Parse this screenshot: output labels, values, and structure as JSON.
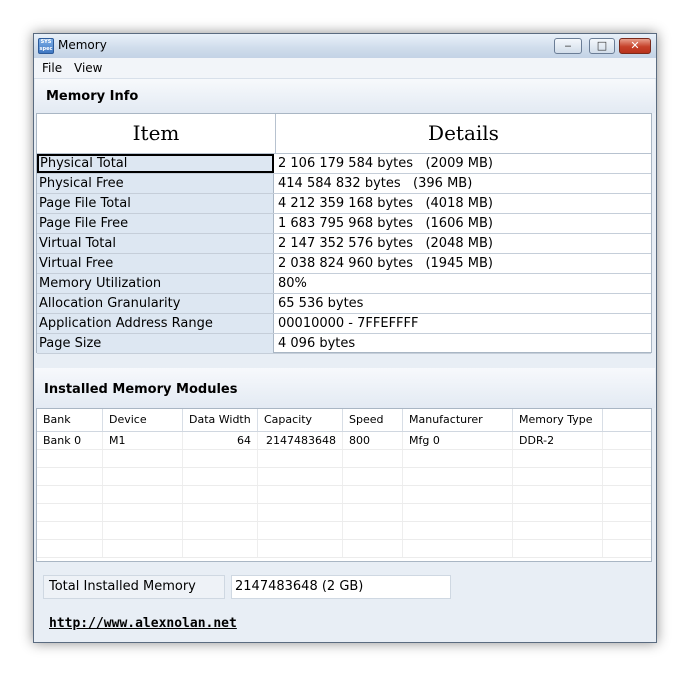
{
  "window": {
    "title": "Memory",
    "icon_text": "SYS spec"
  },
  "menu": [
    "File",
    "View"
  ],
  "memory_info": {
    "section_title": "Memory Info",
    "col_item": "Item",
    "col_details": "Details",
    "rows": [
      {
        "item": "Physical Total",
        "value": "2 106 179 584 bytes   (2009 MB)"
      },
      {
        "item": "Physical Free",
        "value": "414 584 832 bytes   (396 MB)"
      },
      {
        "item": "Page File Total",
        "value": "4 212 359 168 bytes   (4018 MB)"
      },
      {
        "item": "Page File Free",
        "value": "1 683 795 968 bytes   (1606 MB)"
      },
      {
        "item": "Virtual Total",
        "value": "2 147 352 576 bytes   (2048 MB)"
      },
      {
        "item": "Virtual Free",
        "value": "2 038 824 960 bytes   (1945 MB)"
      },
      {
        "item": "Memory Utilization",
        "value": "80%"
      },
      {
        "item": "Allocation Granularity",
        "value": "65 536 bytes"
      },
      {
        "item": "Application Address Range",
        "value": "00010000 - 7FFEFFFF"
      },
      {
        "item": "Page Size",
        "value": "4 096 bytes"
      }
    ]
  },
  "modules": {
    "section_title": "Installed Memory Modules",
    "columns": [
      "Bank",
      "Device",
      "Data Width",
      "Capacity",
      "Speed",
      "Manufacturer",
      "Memory Type"
    ],
    "rows": [
      [
        "Bank 0",
        "M1",
        "64",
        "2147483648",
        "800",
        "Mfg 0",
        "DDR-2"
      ]
    ]
  },
  "total": {
    "label": "Total Installed Memory",
    "value": "2147483648 (2 GB)"
  },
  "link": "http://www.alexnolan.net"
}
